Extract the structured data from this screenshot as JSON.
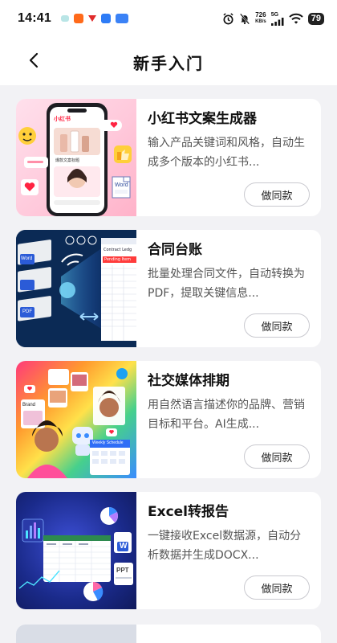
{
  "status_bar": {
    "time": "14:41",
    "net_speed_value": "726",
    "net_speed_unit": "KB/s",
    "network": "5G",
    "battery": "79"
  },
  "nav": {
    "title": "新手入门"
  },
  "cards": [
    {
      "title": "小红书文案生成器",
      "desc": "输入产品关键词和风格，自动生成多个版本的小红书...",
      "button": "做同款"
    },
    {
      "title": "合同台账",
      "desc": "批量处理合同文件，自动转换为PDF，提取关键信息...",
      "button": "做同款"
    },
    {
      "title": "社交媒体排期",
      "desc": "用自然语言描述你的品牌、营销目标和平台。AI生成...",
      "button": "做同款"
    },
    {
      "title": "Excel转报告",
      "desc": "一键接收Excel数据源，自动分析数据并生成DOCX...",
      "button": "做同款"
    }
  ],
  "thumbs": {
    "xhs_app_label": "小红书",
    "xhs_caption": "爆款文案标题",
    "word_label": "Word",
    "pdf_label": "PDF",
    "contract_sheet_title": "Contract Ledg",
    "contract_sheet_status": "Pending Item",
    "brand_label": "Brand",
    "schedule_title": "Weekly Schedule",
    "word_w": "W",
    "ppt_label": "PPT"
  },
  "colors": {
    "accent_red": "#ff2442",
    "contract_bg": "#0b2a55",
    "excel_bg": "#1a2a8a"
  }
}
